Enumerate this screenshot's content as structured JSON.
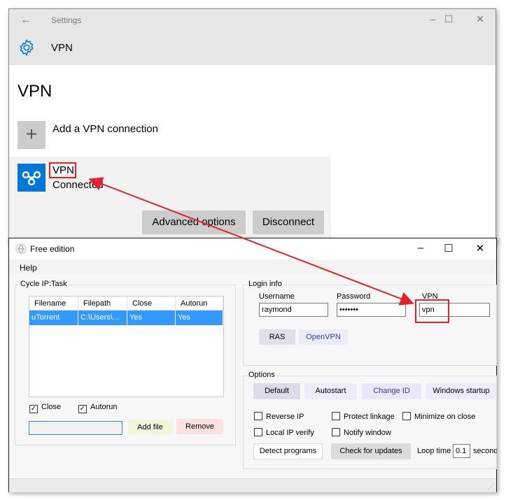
{
  "settings_window": {
    "title": "Settings",
    "back_icon": "back-arrow-icon",
    "controls": {
      "minimize": "–",
      "maximize": "☐",
      "close": "✕"
    },
    "header": {
      "icon": "gear-icon",
      "title": "VPN"
    },
    "page_title": "VPN",
    "add_connection": {
      "icon": "plus-icon",
      "plus": "+",
      "label": "Add a VPN connection"
    },
    "vpn_connection": {
      "icon": "vpn-icon",
      "name": "VPN",
      "status": "Connected",
      "buttons": [
        "Advanced options",
        "Disconnect"
      ]
    },
    "colors": {
      "accent": "#0078d7",
      "header_bg": "#e6e6e6",
      "button_bg": "#cccccc"
    }
  },
  "app_window": {
    "title": "Free edition",
    "icon": "app-logo-icon",
    "controls": {
      "minimize": "–",
      "maximize": "☐",
      "close": "✕"
    },
    "menu": [
      "Help"
    ],
    "cycle_ip": {
      "legend": "Cycle IP:Task",
      "columns": [
        "Filename",
        "Filepath",
        "Close",
        "Autorun"
      ],
      "rows": [
        {
          "filename": "uTorrent",
          "filepath": "C:\\Users\\...",
          "close": "Yes",
          "autorun": "Yes",
          "selected": true
        }
      ],
      "checkboxes": [
        {
          "label": "Close",
          "checked": true
        },
        {
          "label": "Autorun",
          "checked": true
        }
      ],
      "file_input": {
        "value": ""
      },
      "add_file_label": "Add file",
      "remove_label": "Remove"
    },
    "login_info": {
      "legend": "Login info",
      "username_label": "Username",
      "username_value": "raymond",
      "password_label": "Password",
      "password_value": "•••••••",
      "vpn_label": "VPN",
      "vpn_value": "vpn",
      "buttons": [
        "RAS",
        "OpenVPN"
      ]
    },
    "options": {
      "legend": "Options",
      "tabs": [
        "Default",
        "Autostart",
        "Change ID",
        "Windows startup"
      ],
      "checkboxes": [
        {
          "label": "Reverse IP",
          "checked": false
        },
        {
          "label": "Protect linkage",
          "checked": false
        },
        {
          "label": "Minimize on close",
          "checked": false
        },
        {
          "label": "Local IP verify",
          "checked": false
        },
        {
          "label": "Notify window",
          "checked": false
        }
      ],
      "detect_programs_label": "Detect programs",
      "check_updates_label": "Check for updates",
      "loop_time_label": "Loop time",
      "loop_time_value": "0.1",
      "loop_time_unit": "second"
    },
    "colors": {
      "selection": "#3399ff",
      "add_btn": "#f0f5dc",
      "remove_btn": "#fde0e0",
      "tab_bg": "#e8e8f6"
    }
  },
  "annotations": {
    "highlight_color": "#e0232b",
    "arrow": "red arrow linking VPN name to VPN field"
  }
}
